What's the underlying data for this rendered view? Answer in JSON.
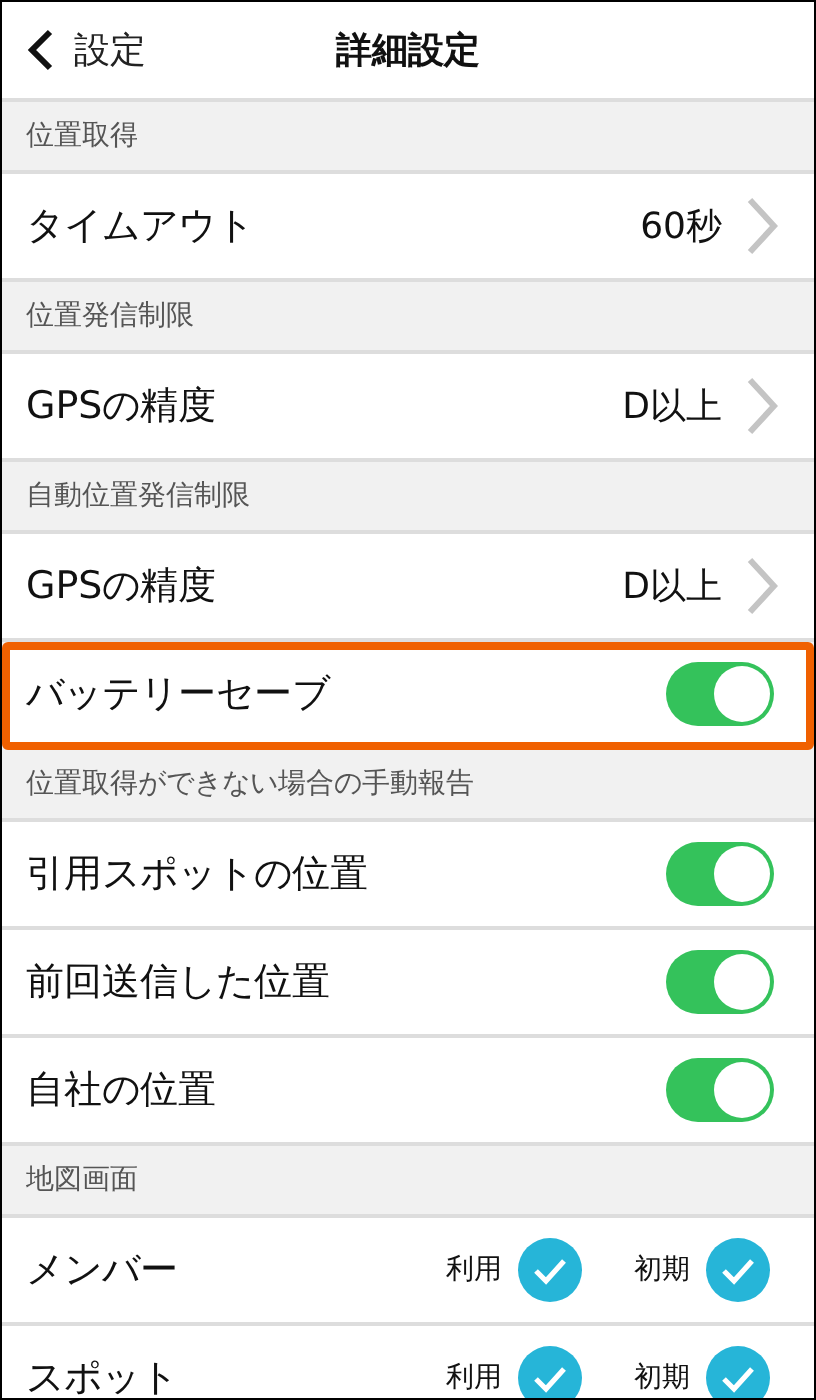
{
  "nav": {
    "back": "設定",
    "title": "詳細設定"
  },
  "sections": [
    {
      "title": "位置取得",
      "items": [
        {
          "kind": "nav",
          "label": "タイムアウト",
          "value": "60秒",
          "highlighted": false
        }
      ]
    },
    {
      "title": "位置発信制限",
      "items": [
        {
          "kind": "nav",
          "label": "GPSの精度",
          "value": "D以上",
          "highlighted": false
        }
      ]
    },
    {
      "title": "自動位置発信制限",
      "items": [
        {
          "kind": "nav",
          "label": "GPSの精度",
          "value": "D以上",
          "highlighted": false
        },
        {
          "kind": "toggle",
          "label": "バッテリーセーブ",
          "on": true,
          "highlighted": true
        }
      ]
    },
    {
      "title": "位置取得ができない場合の手動報告",
      "items": [
        {
          "kind": "toggle",
          "label": "引用スポットの位置",
          "on": true,
          "highlighted": false
        },
        {
          "kind": "toggle",
          "label": "前回送信した位置",
          "on": true,
          "highlighted": false
        },
        {
          "kind": "toggle",
          "label": "自社の位置",
          "on": true,
          "highlighted": false
        }
      ]
    },
    {
      "title": "地図画面",
      "items": [
        {
          "kind": "checks",
          "label": "メンバー",
          "highlighted": false,
          "checks": [
            {
              "label": "利用",
              "checked": true
            },
            {
              "label": "初期",
              "checked": true
            }
          ]
        },
        {
          "kind": "checks",
          "label": "スポット",
          "highlighted": false,
          "checks": [
            {
              "label": "利用",
              "checked": true
            },
            {
              "label": "初期",
              "checked": true
            }
          ]
        }
      ]
    }
  ]
}
